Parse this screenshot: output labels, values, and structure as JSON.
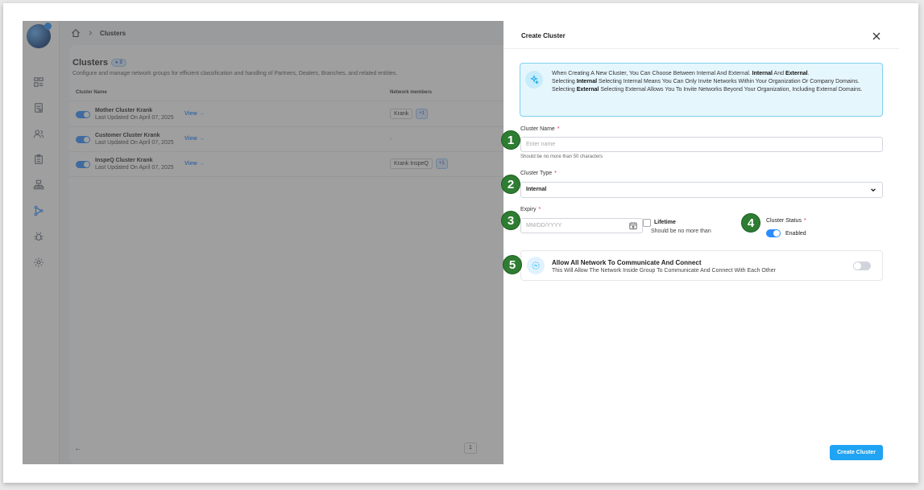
{
  "breadcrumb": {
    "current": "Clusters"
  },
  "page": {
    "title": "Clusters",
    "count": "3",
    "subtitle": "Configure and manage network groups for efficient classification and handling of Partners, Dealers, Branches, and related entities."
  },
  "table": {
    "headers": {
      "name": "Cluster Name",
      "members": "Network members"
    },
    "rows": [
      {
        "name": "Mother Cluster Krank",
        "updated": "Last Updated On April 07, 2025",
        "view": "View",
        "members": [
          "Krank"
        ],
        "more": "+1"
      },
      {
        "name": "Customer Cluster Krank",
        "updated": "Last Updated On April 07, 2025",
        "view": "View",
        "members": [],
        "empty": "-"
      },
      {
        "name": "InspeQ Cluster Krank",
        "updated": "Last Updated On April 07, 2025",
        "view": "View",
        "members": [
          "Krank InspeQ"
        ],
        "more": "+1"
      }
    ]
  },
  "pager": {
    "prev": "←",
    "page": "1"
  },
  "panel": {
    "title": "Create Cluster",
    "info": {
      "line1_pre": "When Creating A New Cluster, You Can Choose Between Internal And External.",
      "line1_b1": "Internal",
      "line1_and": "And",
      "line1_b2": "External",
      "line2_pre": "Selecting",
      "line2_b": "Internal",
      "line2_post": "Selecting Internal Means You Can Only Invite Networks Within Your Organization Or Company Domains.",
      "line3_pre": "Selecting",
      "line3_b": "External",
      "line3_post": "Selecting External Allows You To Invite Networks Beyond Your Organization, Including External Domains."
    },
    "name_field": {
      "label": "Cluster Name",
      "required": "*",
      "placeholder": "Enter name",
      "hint": "Should be no more than 50 characters"
    },
    "type_field": {
      "label": "Cluster Type",
      "required": "*",
      "value": "Internal"
    },
    "expiry_field": {
      "label": "Expiry",
      "required": "*",
      "placeholder": "MM/DD/YYYY"
    },
    "lifetime": {
      "label": "Lifetime",
      "hint": "Should be no more than"
    },
    "status": {
      "label": "Cluster Status",
      "required": "*",
      "value": "Enabled"
    },
    "allow": {
      "title": "Allow All Network To Communicate And Connect",
      "subtitle": "This Will Allow The Network Inside Group To Communicate And Connect With Each Other"
    },
    "submit": "Create Cluster"
  },
  "markers": [
    "1",
    "2",
    "3",
    "4",
    "5"
  ],
  "colors": {
    "accent": "#2b8cff",
    "button": "#1fa3f2",
    "marker": "#2e7d32",
    "info_bg": "#e6f6fd"
  }
}
